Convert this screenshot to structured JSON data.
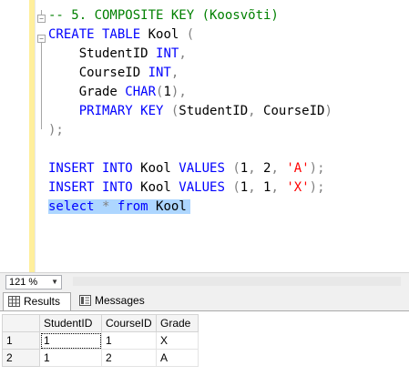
{
  "editor": {
    "lines": [
      [
        {
          "t": "-- 5. COMPOSITE KEY (Koosvõti)",
          "c": "cm"
        }
      ],
      [
        {
          "t": "CREATE TABLE",
          "c": "kw"
        },
        {
          "t": " Kool ",
          "c": ""
        },
        {
          "t": "(",
          "c": "op"
        }
      ],
      [
        {
          "t": "    StudentID ",
          "c": ""
        },
        {
          "t": "INT",
          "c": "kw"
        },
        {
          "t": ",",
          "c": "op"
        }
      ],
      [
        {
          "t": "    CourseID ",
          "c": ""
        },
        {
          "t": "INT",
          "c": "kw"
        },
        {
          "t": ",",
          "c": "op"
        }
      ],
      [
        {
          "t": "    Grade ",
          "c": ""
        },
        {
          "t": "CHAR",
          "c": "kw"
        },
        {
          "t": "(",
          "c": "op"
        },
        {
          "t": "1",
          "c": ""
        },
        {
          "t": "),",
          "c": "op"
        }
      ],
      [
        {
          "t": "    PRIMARY KEY ",
          "c": "kw"
        },
        {
          "t": "(",
          "c": "op"
        },
        {
          "t": "StudentID",
          "c": ""
        },
        {
          "t": ",",
          "c": "op"
        },
        {
          "t": " CourseID",
          "c": ""
        },
        {
          "t": ")",
          "c": "op"
        }
      ],
      [
        {
          "t": ");",
          "c": "op"
        }
      ],
      [],
      [
        {
          "t": "INSERT INTO",
          "c": "kw"
        },
        {
          "t": " Kool ",
          "c": ""
        },
        {
          "t": "VALUES",
          "c": "kw"
        },
        {
          "t": " ",
          "c": ""
        },
        {
          "t": "(",
          "c": "op"
        },
        {
          "t": "1",
          "c": ""
        },
        {
          "t": ",",
          "c": "op"
        },
        {
          "t": " 2",
          "c": ""
        },
        {
          "t": ",",
          "c": "op"
        },
        {
          "t": " ",
          "c": ""
        },
        {
          "t": "'A'",
          "c": "str"
        },
        {
          "t": ");",
          "c": "op"
        }
      ],
      [
        {
          "t": "INSERT INTO",
          "c": "kw"
        },
        {
          "t": " Kool ",
          "c": ""
        },
        {
          "t": "VALUES",
          "c": "kw"
        },
        {
          "t": " ",
          "c": ""
        },
        {
          "t": "(",
          "c": "op"
        },
        {
          "t": "1",
          "c": ""
        },
        {
          "t": ",",
          "c": "op"
        },
        {
          "t": " 1",
          "c": ""
        },
        {
          "t": ",",
          "c": "op"
        },
        {
          "t": " ",
          "c": ""
        },
        {
          "t": "'X'",
          "c": "str"
        },
        {
          "t": ");",
          "c": "op"
        }
      ],
      [
        {
          "t": "select",
          "c": "kw"
        },
        {
          "t": " ",
          "c": ""
        },
        {
          "t": "*",
          "c": "op"
        },
        {
          "t": " ",
          "c": ""
        },
        {
          "t": "from",
          "c": "kw"
        },
        {
          "t": " Kool",
          "c": ""
        }
      ]
    ],
    "selected_line": 10
  },
  "zoom": {
    "value": "121 %"
  },
  "tabs": [
    {
      "label": "Results",
      "icon": "grid-icon",
      "active": true
    },
    {
      "label": "Messages",
      "icon": "messages-icon",
      "active": false
    }
  ],
  "results": {
    "columns": [
      "StudentID",
      "CourseID",
      "Grade"
    ],
    "rows": [
      {
        "num": "1",
        "cells": [
          "1",
          "1",
          "X"
        ]
      },
      {
        "num": "2",
        "cells": [
          "1",
          "2",
          "A"
        ]
      }
    ]
  },
  "colors": {
    "keyword": "#0000ff",
    "comment": "#008000",
    "string": "#ff0000",
    "operator": "#808080",
    "selection": "#add6ff",
    "margin": "#ffef9c"
  }
}
